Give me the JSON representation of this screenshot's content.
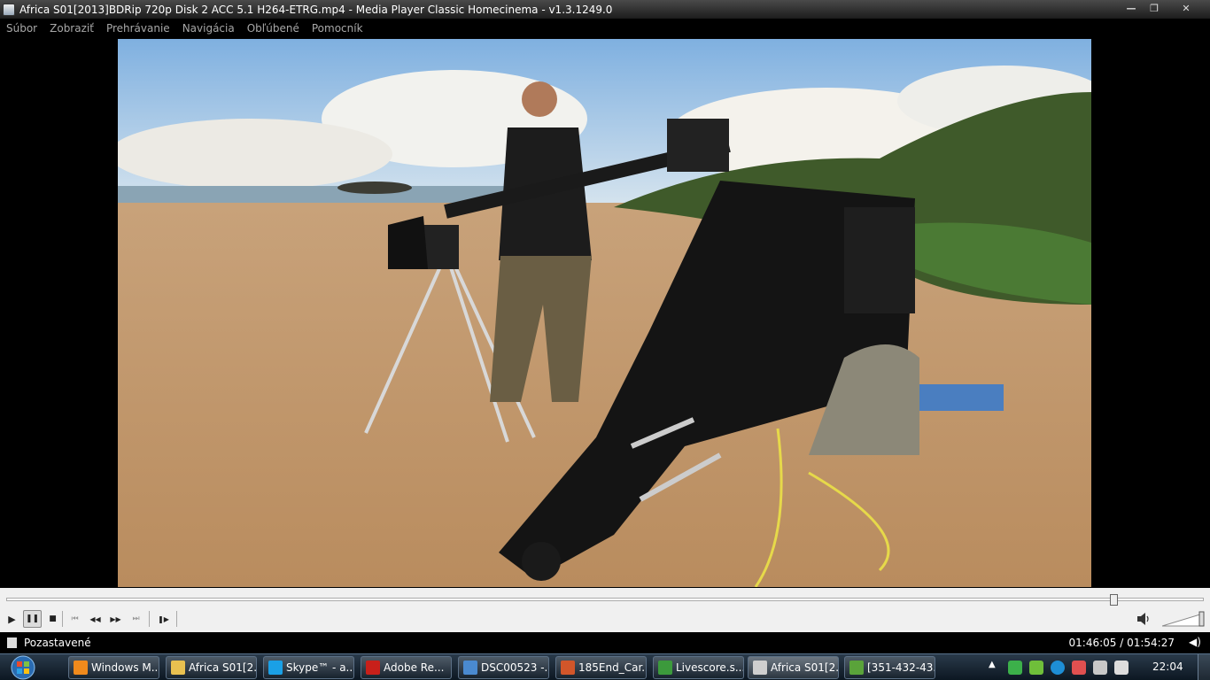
{
  "window": {
    "title": "Africa S01[2013]BDRip 720p Disk 2 ACC 5.1 H264-ETRG.mp4 - Media Player Classic Homecinema - v1.3.1249.0",
    "buttons": {
      "minimize": "—",
      "maximize": "❐",
      "close": "✕"
    }
  },
  "menu": {
    "items": [
      "Súbor",
      "Zobraziť",
      "Prehrávanie",
      "Navigácia",
      "Obľúbené",
      "Pomocník"
    ]
  },
  "player": {
    "seek_progress": 0.925,
    "volume_level": 1.0,
    "controls": {
      "play": "▶",
      "pause": "❚❚",
      "stop": "■",
      "prev": "⏮",
      "rewind": "◀◀",
      "forward": "▶▶",
      "next": "⏭",
      "frame_step": "❚▶"
    }
  },
  "status": {
    "text": "Pozastavené",
    "time": "01:46:05 / 01:54:27"
  },
  "taskbar": {
    "tasks": [
      {
        "label": "Windows M...",
        "icon": "media-player-icon",
        "color": "#f08a1c",
        "active": false
      },
      {
        "label": "Africa S01[2...",
        "icon": "folder-icon",
        "color": "#e8c050",
        "active": false
      },
      {
        "label": "Skype™ - a...",
        "icon": "skype-icon",
        "color": "#1aa0e6",
        "active": false
      },
      {
        "label": "Adobe Re...",
        "icon": "adobe-reader-icon",
        "color": "#c8201a",
        "active": false
      },
      {
        "label": "DSC00523 -...",
        "icon": "image-viewer-icon",
        "color": "#4a8ad0",
        "active": false
      },
      {
        "label": "185End_Car...",
        "icon": "powerpoint-icon",
        "color": "#d2562a",
        "active": false
      },
      {
        "label": "Livescore.s...",
        "icon": "chrome-icon",
        "color": "#3c9a3c",
        "active": false
      },
      {
        "label": "Africa S01[2...",
        "icon": "mpc-icon",
        "color": "#cfcfcf",
        "active": true
      },
      {
        "label": "[351-432-43...",
        "icon": "spreadsheet-icon",
        "color": "#5aa33a",
        "active": false
      }
    ],
    "tray_arrow": "▲",
    "clock": "22:04"
  }
}
